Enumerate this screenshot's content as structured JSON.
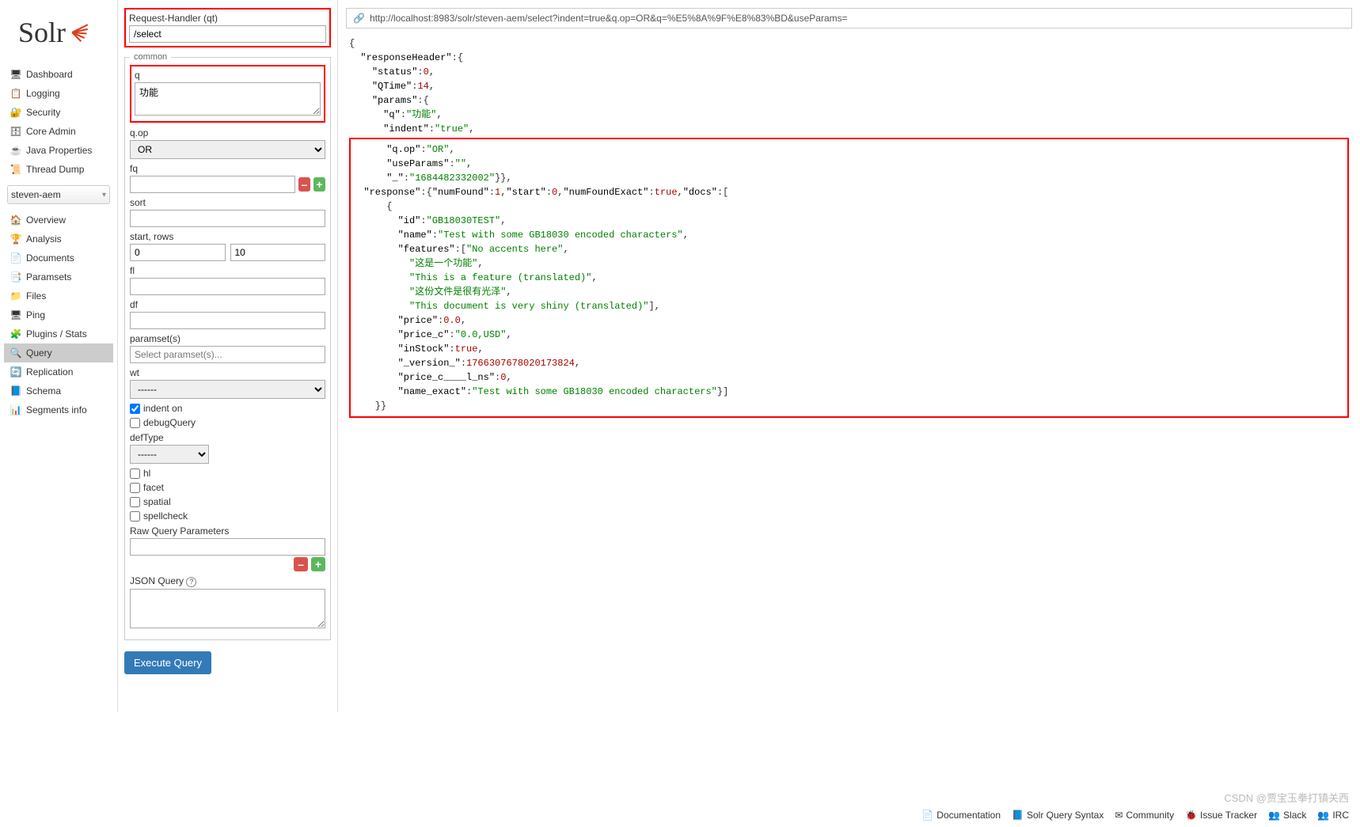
{
  "logo_text": "Solr",
  "nav": [
    {
      "icon": "🖥",
      "label": "Dashboard"
    },
    {
      "icon": "📋",
      "label": "Logging"
    },
    {
      "icon": "🔐",
      "label": "Security"
    },
    {
      "icon": "🗄",
      "label": "Core Admin"
    },
    {
      "icon": "☕",
      "label": "Java Properties"
    },
    {
      "icon": "📜",
      "label": "Thread Dump"
    }
  ],
  "core_selected": "steven-aem",
  "sub_nav": [
    {
      "icon": "🏠",
      "label": "Overview"
    },
    {
      "icon": "🏆",
      "label": "Analysis"
    },
    {
      "icon": "📄",
      "label": "Documents"
    },
    {
      "icon": "📑",
      "label": "Paramsets"
    },
    {
      "icon": "📁",
      "label": "Files"
    },
    {
      "icon": "🖥",
      "label": "Ping"
    },
    {
      "icon": "🧩",
      "label": "Plugins / Stats"
    },
    {
      "icon": "🔍",
      "label": "Query",
      "active": true
    },
    {
      "icon": "🔄",
      "label": "Replication"
    },
    {
      "icon": "📘",
      "label": "Schema"
    },
    {
      "icon": "📊",
      "label": "Segments info"
    }
  ],
  "form": {
    "qt_label": "Request-Handler (qt)",
    "qt_value": "/select",
    "common_legend": "common",
    "q_label": "q",
    "q_value": "功能",
    "qop_label": "q.op",
    "qop_value": "OR",
    "fq_label": "fq",
    "sort_label": "sort",
    "startrows_label": "start, rows",
    "start_value": "0",
    "rows_value": "10",
    "fl_label": "fl",
    "df_label": "df",
    "paramsets_label": "paramset(s)",
    "paramsets_placeholder": "Select paramset(s)...",
    "wt_label": "wt",
    "wt_value": "------",
    "indent_label": "indent on",
    "debug_label": "debugQuery",
    "defType_label": "defType",
    "defType_value": "------",
    "hl_label": "hl",
    "facet_label": "facet",
    "spatial_label": "spatial",
    "spellcheck_label": "spellcheck",
    "raw_label": "Raw Query Parameters",
    "json_label": "JSON Query",
    "exec_label": "Execute Query"
  },
  "url_bar": "http://localhost:8983/solr/steven-aem/select?indent=true&q.op=OR&q=%E5%8A%9F%E8%83%BD&useParams=",
  "response": {
    "header": {
      "status": 0,
      "QTime": 14,
      "params": {
        "q": "功能",
        "indent": "true",
        "q.op": "OR",
        "useParams": "",
        "_": "1684482332002"
      }
    },
    "body": {
      "numFound": 1,
      "start": 0,
      "numFoundExact": true,
      "doc": {
        "id": "GB18030TEST",
        "name": "Test with some GB18030 encoded characters",
        "features": [
          "No accents here",
          "这是一个功能",
          "This is a feature (translated)",
          "这份文件是很有光泽",
          "This document is very shiny (translated)"
        ],
        "price": "0.0",
        "price_c": "0.0,USD",
        "inStock": true,
        "_version_": "1766307678020173824",
        "price_c____l_ns": 0,
        "name_exact": "Test with some GB18030 encoded characters"
      }
    }
  },
  "footer": [
    {
      "icon": "📄",
      "label": "Documentation"
    },
    {
      "icon": "📘",
      "label": "Solr Query Syntax"
    },
    {
      "icon": "✉",
      "label": "Community"
    },
    {
      "icon": "🐞",
      "label": "Issue Tracker"
    },
    {
      "icon": "👥",
      "label": "Slack"
    },
    {
      "icon": "👥",
      "label": "IRC"
    }
  ],
  "watermark": "CSDN @贾宝玉拳打镇关西"
}
